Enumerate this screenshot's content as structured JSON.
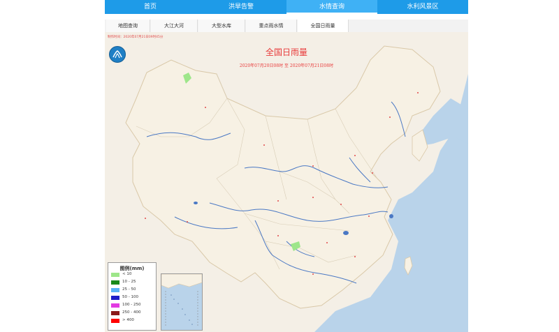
{
  "nav": {
    "items": [
      "首页",
      "洪旱告警",
      "水情查询",
      "水利风景区"
    ],
    "active_index": 2
  },
  "subtabs": {
    "items": [
      "地图查询",
      "大江大河",
      "大型水库",
      "重点雨水情",
      "全国日雨量"
    ],
    "active_index": 4
  },
  "map": {
    "updated": "制作时间：2020年07月21日09时45分",
    "title": "全国日雨量",
    "period": "2020年07月20日08时 至 2020年07月21日08时"
  },
  "legend": {
    "title": "图例(mm)",
    "items": [
      {
        "label": "< 10",
        "color": "#9ee68a"
      },
      {
        "label": "10 - 25",
        "color": "#1a8a1a"
      },
      {
        "label": "25 - 50",
        "color": "#5ab4f5"
      },
      {
        "label": "50 - 100",
        "color": "#1e1ec8"
      },
      {
        "label": "100 - 250",
        "color": "#e23be2"
      },
      {
        "label": "250 - 400",
        "color": "#8b1a1a"
      },
      {
        "label": "> 400",
        "color": "#ff0000"
      }
    ]
  },
  "colors": {
    "nav_bg": "#1e9be8",
    "title_red": "#e83a3a",
    "river": "#4a78c4",
    "sea": "#b9d3ea",
    "land": "#f4efe6"
  },
  "icons": {
    "logo": "ministry-water-logo"
  }
}
